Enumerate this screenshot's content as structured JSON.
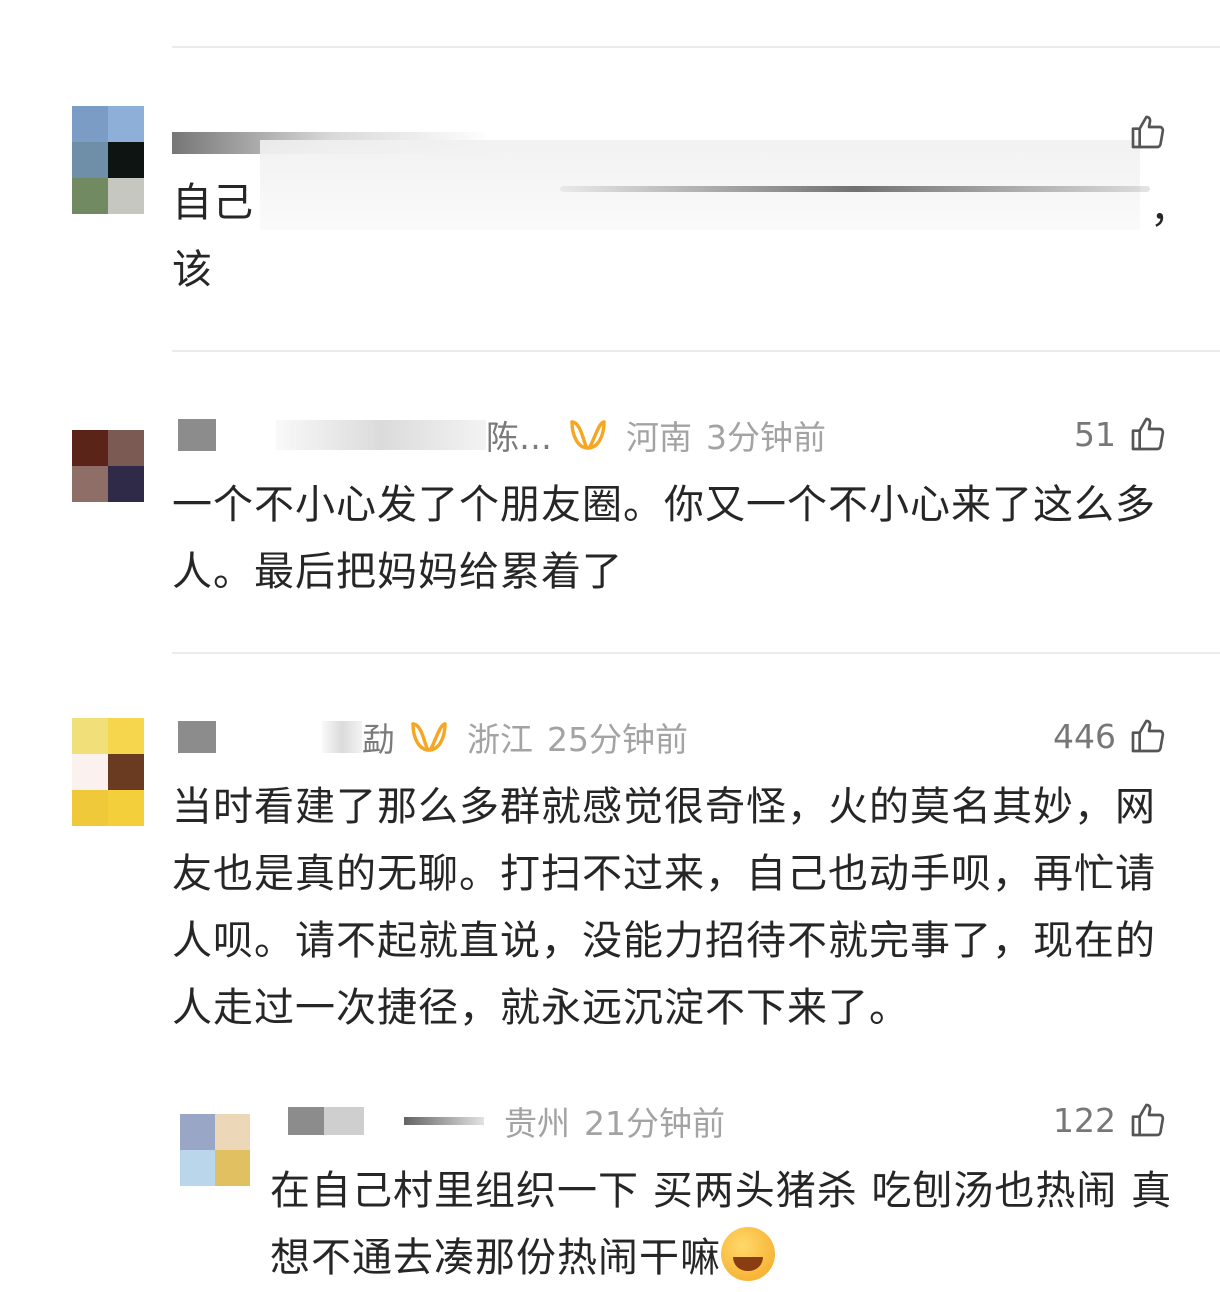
{
  "comments": [
    {
      "username": "",
      "location": "",
      "time": "",
      "likes": "",
      "text_start": "自己",
      "text_comma": "，",
      "text_line2": "该"
    },
    {
      "username": "陈…",
      "location": "河南",
      "time": "3分钟前",
      "likes": "51",
      "text": "一个不小心发了个朋友圈。你又一个不小心来了这么多人。最后把妈妈给累着了"
    },
    {
      "username": "勐",
      "location": "浙江",
      "time": "25分钟前",
      "likes": "446",
      "text": "当时看建了那么多群就感觉很奇怪，火的莫名其妙，网友也是真的无聊。打扫不过来，自己也动手呗，再忙请人呗。请不起就直说，没能力招待不就完事了，现在的人走过一次捷径，就永远沉淀不下来了。",
      "reply": {
        "username": "",
        "location": "贵州",
        "time": "21分钟前",
        "likes": "122",
        "text": "在自己村里组织一下 买两头猪杀 吃刨汤也热闹 真想不通去凑那份热闹干嘛"
      }
    }
  ],
  "colors": {
    "vip_badge": "#f5a623",
    "meta_text": "#a3a3a3",
    "body_text": "#262626",
    "divider": "#ebebeb"
  },
  "icons": {
    "like": "thumbs-up-outline-icon",
    "vip": "vip-badge-icon",
    "emoji": "laughing-crying-emoji"
  }
}
